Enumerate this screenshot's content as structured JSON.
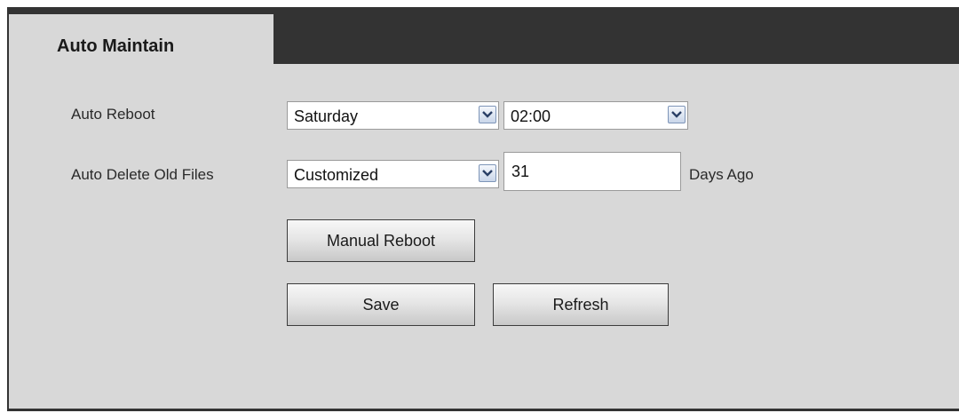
{
  "tab": {
    "title": "Auto Maintain"
  },
  "auto_reboot": {
    "label": "Auto Reboot",
    "day_value": "Saturday",
    "time_value": "02:00"
  },
  "auto_delete": {
    "label": "Auto Delete Old Files",
    "mode_value": "Customized",
    "days_value": "31",
    "suffix": "Days Ago"
  },
  "buttons": {
    "manual_reboot": "Manual Reboot",
    "save": "Save",
    "refresh": "Refresh"
  },
  "icons": {
    "dropdown": "chevron-down-icon"
  }
}
